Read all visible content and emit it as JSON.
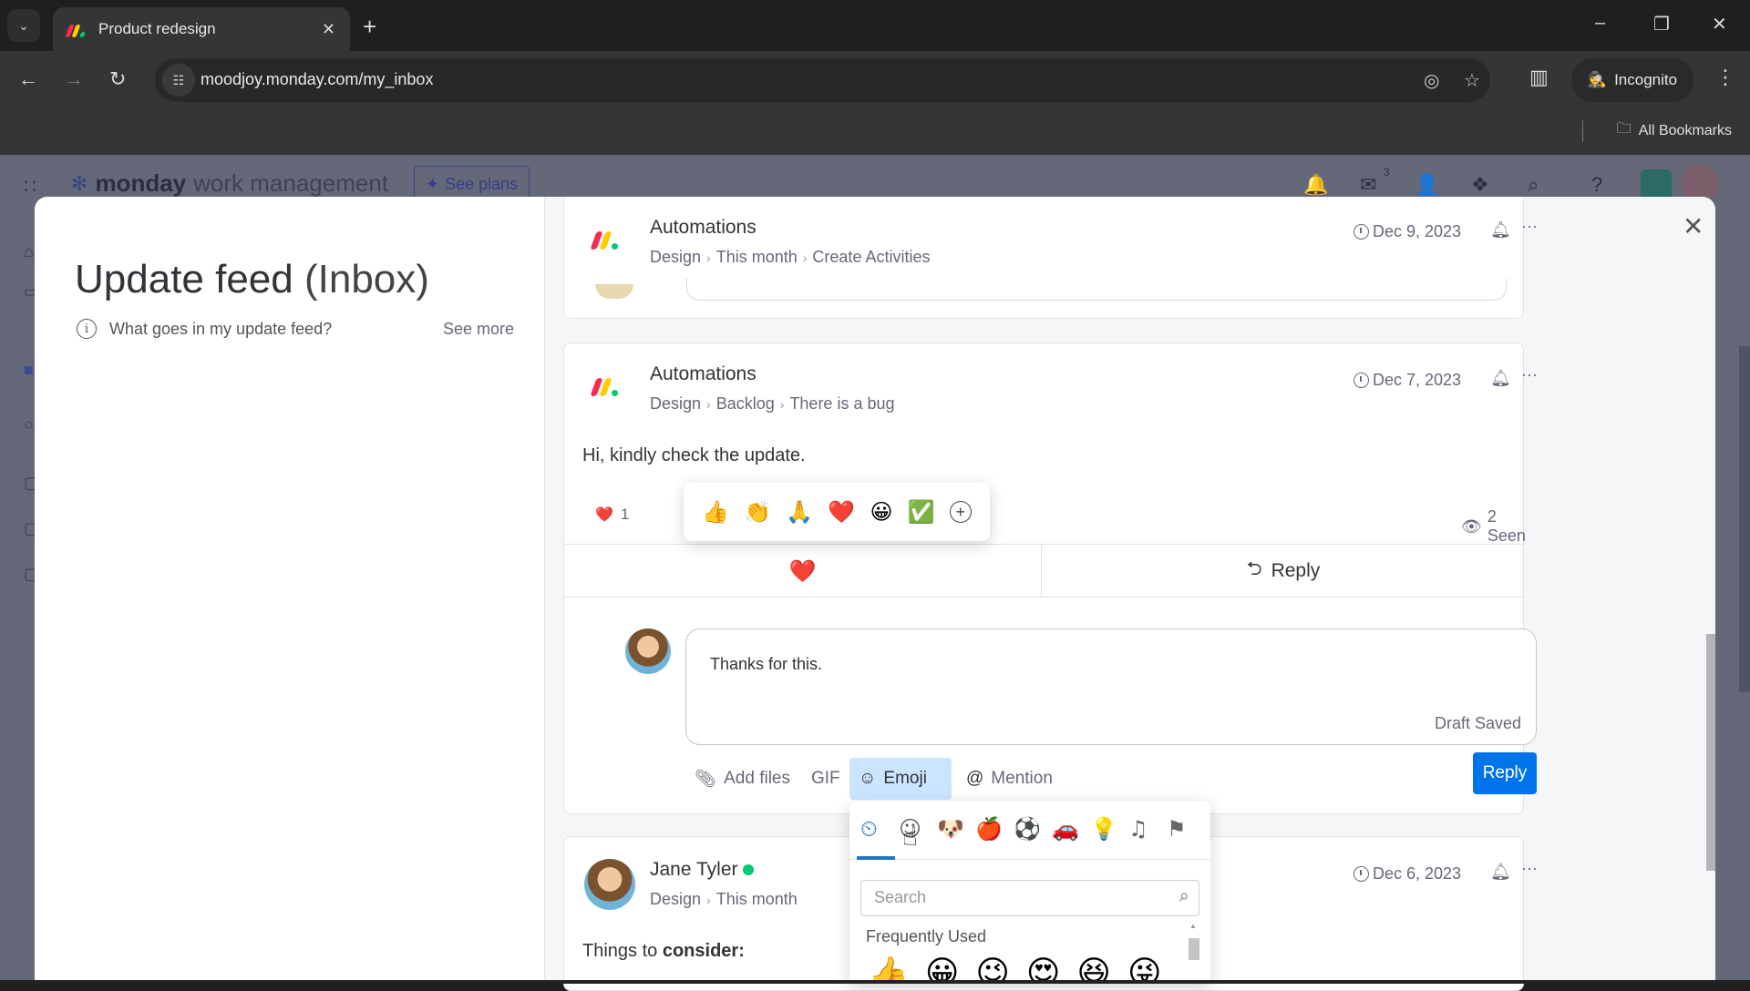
{
  "browser": {
    "tab_title": "Product redesign",
    "url": "moodjoy.monday.com/my_inbox",
    "incognito_label": "Incognito",
    "all_bookmarks_label": "All Bookmarks",
    "icons": {
      "tab_list": "⌄",
      "tab_close": "✕",
      "new_tab": "+",
      "minimize": "–",
      "restore": "❐",
      "close": "✕",
      "back": "←",
      "forward": "→",
      "reload": "↻",
      "site_info": "☷",
      "eye_off": "◎",
      "star": "☆",
      "side_panel": "▥",
      "incognito": "🕵",
      "menu": "⋮",
      "folder": "🗀"
    }
  },
  "app": {
    "logo_bold": "monday",
    "logo_light": "work management",
    "see_plans_label": "See plans",
    "inbox_badge": "3",
    "top_icons": {
      "grid": "∷",
      "bell": "🔔",
      "inbox": "✉",
      "invite": "👤",
      "apps": "❖",
      "search": "⌕",
      "help": "?"
    }
  },
  "modal": {
    "title_main": "Update feed",
    "title_sub": "(Inbox)",
    "info_text": "What goes in my update feed?",
    "see_more_label": "See more",
    "close_icon": "✕"
  },
  "feed": [
    {
      "author": "Automations",
      "breadcrumb": [
        "Design",
        "This month",
        "Create Activities"
      ],
      "date": "Dec 9, 2023"
    },
    {
      "author": "Automations",
      "breadcrumb": [
        "Design",
        "Backlog",
        "There is a bug"
      ],
      "date": "Dec 7, 2023",
      "body": "Hi, kindly check the update.",
      "reaction_summary": {
        "emoji": "❤️",
        "count": "1"
      },
      "seen_label": "2 Seen",
      "like_emoji": "❤️",
      "reply_label": "Reply",
      "reaction_options": [
        "👍",
        "👏",
        "🙏",
        "❤️",
        "😀",
        "✅",
        "+"
      ]
    },
    {
      "author": "Jane Tyler",
      "online": true,
      "breadcrumb": [
        "Design",
        "This month"
      ],
      "date": "Dec 6, 2023",
      "body_prefix": "Things to ",
      "body_bold": "consider:"
    }
  ],
  "composer": {
    "text": "Thanks for this.",
    "status": "Draft Saved",
    "tools": {
      "add_files": "Add files",
      "gif": "GIF",
      "emoji": "Emoji",
      "mention": "Mention"
    },
    "reply_button": "Reply"
  },
  "emoji_picker": {
    "tabs": [
      {
        "name": "recent",
        "glyph": "⏲"
      },
      {
        "name": "smileys",
        "glyph": "☺"
      },
      {
        "name": "animals",
        "glyph": "🐶"
      },
      {
        "name": "food",
        "glyph": "🍎"
      },
      {
        "name": "activity",
        "glyph": "⚽"
      },
      {
        "name": "travel",
        "glyph": "🚗"
      },
      {
        "name": "objects",
        "glyph": "💡"
      },
      {
        "name": "symbols",
        "glyph": "♫"
      },
      {
        "name": "flags",
        "glyph": "⚑"
      }
    ],
    "active_tab": "recent",
    "search_placeholder": "Search",
    "section_label": "Frequently Used",
    "frequently_used": [
      "👍",
      "😀",
      "😉",
      "😍",
      "😆",
      "😜"
    ]
  },
  "colors": {
    "brand_blue": "#0073ea",
    "online_green": "#00c875",
    "emoji_tool_active_bg": "#cce5ff"
  }
}
